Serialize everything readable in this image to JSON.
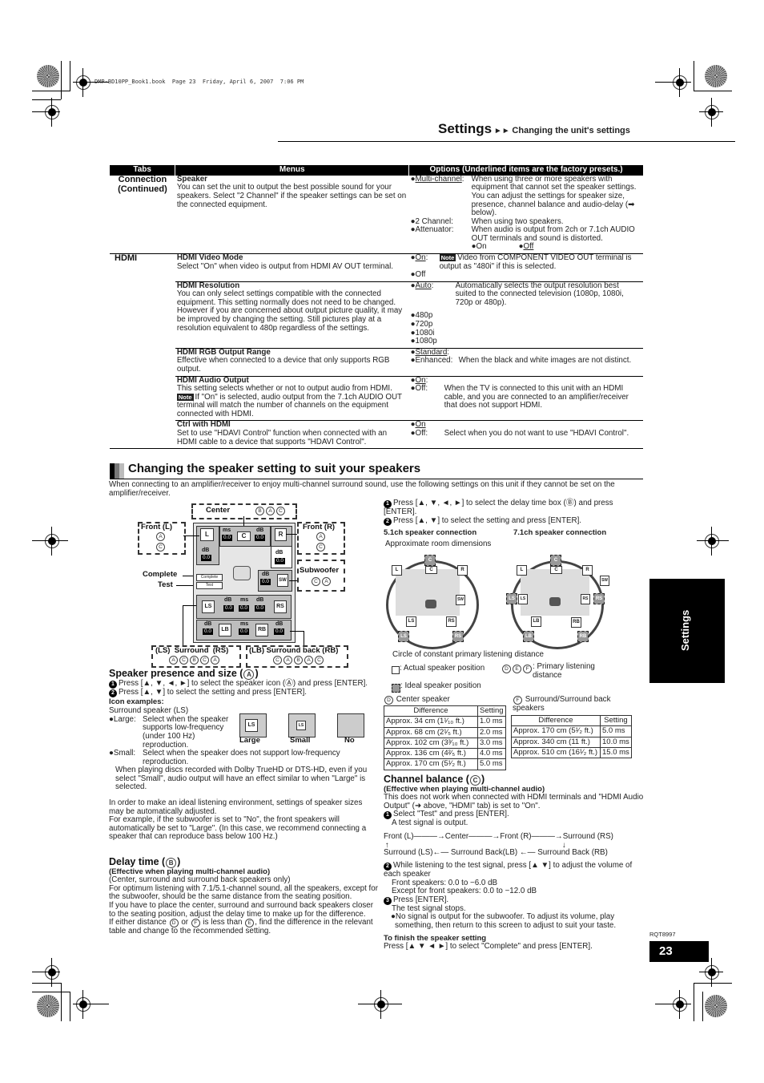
{
  "print_header": "DMP-BD10PP_Book1.book  Page 23  Friday, April 6, 2007  7:06 PM",
  "header": {
    "title": "Settings",
    "arrows": "►►",
    "subtitle": "Changing the unit's settings"
  },
  "settings_table": {
    "columns": [
      "Tabs",
      "Menus",
      "Options (Underlined items are the factory presets.)"
    ],
    "connection": {
      "tab": "Connection (Continued)",
      "menu_title": "Speaker",
      "menu_desc": "You can set the unit to output the best possible sound for your speakers. Select \"2 Channel\" if the speaker settings can be set on the connected equipment.",
      "options": [
        {
          "key": "Multi-channel",
          "sep": ":",
          "underlined": true,
          "desc": "When using three or more speakers with equipment that cannot set the speaker settings. You can adjust the settings for speaker size, presence, channel balance and audio-delay (➡ below)."
        },
        {
          "key": "2 Channel",
          "sep": ":",
          "underlined": false,
          "desc": "When using two speakers."
        },
        {
          "key": "Attenuator",
          "sep": ":",
          "underlined": false,
          "desc": "When audio is output from 2ch or 7.1ch AUDIO OUT terminals and sound is distorted."
        }
      ],
      "attenuator_choices": [
        {
          "label": "On",
          "underlined": false
        },
        {
          "label": "Off",
          "underlined": true
        }
      ]
    },
    "hdmi": {
      "tab": "HDMI",
      "rows": [
        {
          "menu_title": "HDMI Video Mode",
          "menu_desc": "Select \"On\" when video is output from HDMI AV OUT terminal.",
          "options": [
            {
              "key": "On",
              "underlined": true,
              "note": "Note",
              "desc": "Video from COMPONENT VIDEO OUT terminal is output as \"480i\" if this is selected."
            },
            {
              "key": "Off",
              "underlined": false,
              "desc": ""
            }
          ]
        },
        {
          "menu_title": "HDMI Resolution",
          "menu_desc": "You can only select settings compatible with the connected equipment. This setting normally does not need to be changed. However if you are concerned about output picture quality, it may be improved by changing the setting. Still pictures play at a resolution equivalent to 480p regardless of the settings.",
          "options": [
            {
              "key": "Auto",
              "underlined": true,
              "desc": "Automatically selects the output resolution best suited to the connected television (1080p, 1080i, 720p or 480p)."
            },
            {
              "key": "480p",
              "underlined": false,
              "desc": ""
            },
            {
              "key": "720p",
              "underlined": false,
              "desc": ""
            },
            {
              "key": "1080i",
              "underlined": false,
              "desc": ""
            },
            {
              "key": "1080p",
              "underlined": false,
              "desc": ""
            }
          ]
        },
        {
          "menu_title": "HDMI RGB Output Range",
          "menu_desc": "Effective when connected to a device that only supports RGB output.",
          "options": [
            {
              "key": "Standard",
              "underlined": true,
              "desc": ""
            },
            {
              "key": "Enhanced",
              "underlined": false,
              "desc": "When the black and white images are not distinct."
            }
          ]
        },
        {
          "menu_title": "HDMI Audio Output",
          "menu_desc": "This setting selects whether or not to output audio from HDMI.",
          "note": "Note",
          "note_text": "If \"On\" is selected, audio output from the 7.1ch AUDIO OUT terminal will match the number of channels on the equipment connected with HDMI.",
          "options": [
            {
              "key": "On",
              "underlined": true,
              "desc": ""
            },
            {
              "key": "Off",
              "underlined": false,
              "desc": "When the TV is connected to this unit with an HDMI cable, and you are connected to an amplifier/receiver that does not support HDMI."
            }
          ]
        },
        {
          "menu_title": "Ctrl with HDMI",
          "menu_desc": "Set to use \"HDAVI Control\" function when connected with an HDMI cable to a device that supports \"HDAVI Control\".",
          "options": [
            {
              "key": "On",
              "underlined": true,
              "desc": ""
            },
            {
              "key": "Off",
              "underlined": false,
              "desc": "Select when you do not want to use \"HDAVI Control\"."
            }
          ]
        }
      ]
    }
  },
  "section": {
    "title": "Changing the speaker setting to suit your speakers",
    "intro": "When connecting to an amplifier/receiver to enjoy multi-channel surround sound, use the following settings on this unit if they cannot be set on the amplifier/receiver."
  },
  "diagram": {
    "callouts": {
      "center": "Center",
      "center_marks": [
        "B",
        "A",
        "C"
      ],
      "front_l": "Front (L)",
      "front_l_marks": [
        "A",
        "C"
      ],
      "front_r": "Front (R)",
      "front_r_marks": [
        "A",
        "C"
      ],
      "subwoofer": "Subwoofer",
      "subwoofer_marks": [
        "C",
        "A"
      ],
      "complete": "Complete",
      "test": "Test",
      "surround": "(LS)  Surround  (RS)",
      "surround_marks": [
        "A",
        "C",
        "B",
        "C",
        "A"
      ],
      "surround_back": "(LB) Surround back (RB)",
      "surround_back_marks": [
        "C",
        "A",
        "B",
        "A",
        "C"
      ]
    },
    "speakers": {
      "L": "L",
      "C": "C",
      "R": "R",
      "SW": "SW",
      "LS": "LS",
      "RS": "RS",
      "LB": "LB",
      "RB": "RB"
    },
    "units": {
      "ms": "ms",
      "db": "dB"
    },
    "value": "0.0",
    "buttons": {
      "complete": "Complete",
      "test": "Test"
    }
  },
  "presence": {
    "title": "Speaker presence and size (",
    "mark": "A",
    "steps": [
      "Press [▲, ▼, ◄, ►] to select the speaker icon (Ⓐ) and press [ENTER].",
      "Press [▲, ▼] to select the setting and press [ENTER]."
    ],
    "icon_examples_label": "Icon examples:",
    "icon_example_sub": "Surround speaker (LS)",
    "icons": [
      {
        "label": "Large",
        "spk": "LS"
      },
      {
        "label": "Small",
        "spk": "LS"
      },
      {
        "label": "No",
        "spk": ""
      }
    ],
    "large_key": "Large",
    "large_desc": "Select when the speaker supports low-frequency (under 100 Hz) reproduction.",
    "small_key": "Small",
    "small_desc": "Select when the speaker does not support low-frequency reproduction.",
    "dolby_note": "When playing discs recorded with Dolby TrueHD or DTS-HD, even if you select \"Small\", audio output will have an effect similar to when \"Large\" is selected.",
    "auto_note": "In order to make an ideal listening environment, settings of speaker sizes may be automatically adjusted.\nFor example, if the subwoofer is set to \"No\", the front speakers will automatically be set to \"Large\". (In this case, we recommend connecting a speaker that can reproduce bass below 100 Hz.)"
  },
  "delay": {
    "title": "Delay time (",
    "mark": "B",
    "subtitle": "(Effective when playing multi-channel audio)",
    "body": "(Center, surround and surround back speakers only)\nFor optimum listening with 7.1/5.1-channel sound, all the speakers, except for the subwoofer, should be the same distance from the seating position.\nIf you have to place the center, surround and surround back speakers closer to the seating position, adjust the delay time to make up for the difference.",
    "last_pre": "If either distance ",
    "last_d": "D",
    "last_or": " or ",
    "last_f": "F",
    "last_mid": " is less than ",
    "last_e": "E",
    "last_post": ", find the difference in the relevant table and change to the recommended setting.",
    "steps": [
      "Press [▲, ▼, ◄, ►] to select the delay time box (Ⓑ) and press [ENTER].",
      "Press [▲, ▼] to select the setting and press [ENTER]."
    ]
  },
  "room": {
    "label_51": "5.1ch speaker connection",
    "label_71": "7.1ch speaker connection",
    "dims": "Approximate room dimensions",
    "circle": "Circle of constant primary listening distance",
    "actual": ": Actual speaker position",
    "primary": ": Primary listening distance",
    "ideal": ": Ideal speaker position",
    "marks": [
      "D",
      "E",
      "F"
    ]
  },
  "center_table": {
    "title": "Center speaker",
    "mark": "D",
    "headers": [
      "Difference",
      "Setting"
    ],
    "rows": [
      [
        "Approx. 34 cm (1¹⁄₁₀ ft.)",
        "1.0 ms"
      ],
      [
        "Approx. 68 cm (2¹⁄₅ ft.)",
        "2.0 ms"
      ],
      [
        "Approx. 102 cm (3³⁄₁₀ ft.)",
        "3.0 ms"
      ],
      [
        "Approx. 136 cm (4²⁄₅ ft.)",
        "4.0 ms"
      ],
      [
        "Approx. 170 cm (5¹⁄₂ ft.)",
        "5.0 ms"
      ]
    ]
  },
  "surround_table": {
    "title": "Surround/Surround back speakers",
    "mark": "F",
    "headers": [
      "Difference",
      "Setting"
    ],
    "rows": [
      [
        "Approx. 170 cm (5¹⁄₂ ft.)",
        "5.0 ms"
      ],
      [
        "Approx. 340 cm (11 ft.)",
        "10.0 ms"
      ],
      [
        "Approx. 510 cm (16¹⁄₂ ft.)",
        "15.0 ms"
      ]
    ]
  },
  "balance": {
    "title": "Channel balance (",
    "mark": "C",
    "subtitle": "(Effective when playing multi-channel audio)",
    "note": "This does not work when connected with HDMI terminals and \"HDMI Audio Output\" (➜ above, \"HDMI\" tab) is set to \"On\".",
    "step1": "Select \"Test\" and press [ENTER].",
    "step1_sub": "A test signal is output.",
    "flow_top": "Front (L)———→Center———→Front (R)———→Surround (RS)",
    "flow_bottom": "Surround (LS)←— Surround Back(LB) ←— Surround Back (RB)",
    "step2": "While listening to the test signal, press [▲ ▼] to adjust the volume of each speaker",
    "step2_a": "Front speakers: 0.0 to −6.0 dB",
    "step2_b": "Except for front speakers: 0.0 to −12.0 dB",
    "step3": "Press [ENTER].",
    "step3_sub": "The test signal stops.",
    "step3_bullet": "No signal is output for the subwoofer. To adjust its volume, play something, then return to this screen to adjust to suit your taste.",
    "finish_title": "To finish the speaker setting",
    "finish_text": "Press [▲ ▼ ◄ ►] to select \"Complete\" and press [ENTER]."
  },
  "side_tab": "Settings",
  "doc_code": "RQT8997",
  "page_number": "23"
}
